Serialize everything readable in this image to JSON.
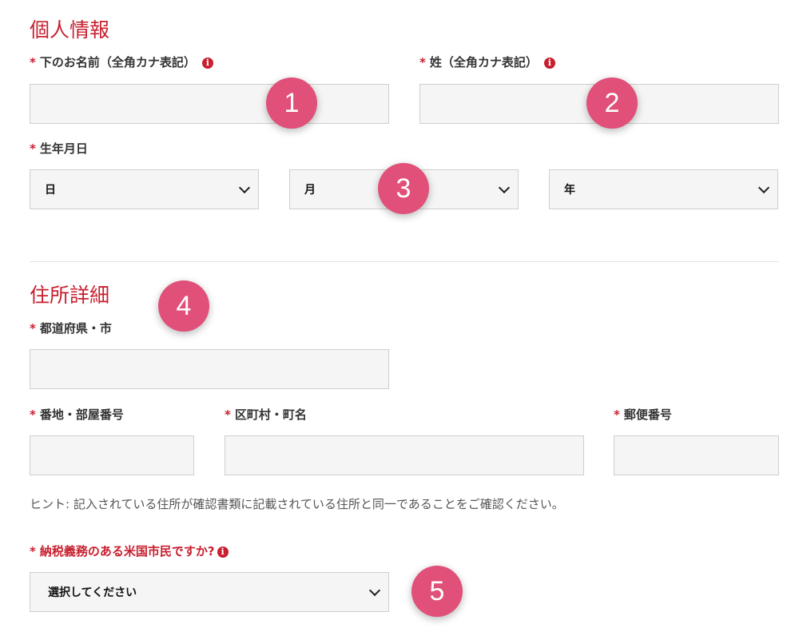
{
  "personal": {
    "title": "個人情報",
    "first_name": {
      "label": "下のお名前（全角カナ表記）",
      "value": ""
    },
    "last_name": {
      "label": "姓（全角カナ表記）",
      "value": ""
    },
    "birthdate": {
      "label": "生年月日",
      "day": "日",
      "month": "月",
      "year": "年"
    }
  },
  "address": {
    "title": "住所詳細",
    "prefecture_city": {
      "label": "都道府県・市",
      "value": ""
    },
    "street_room": {
      "label": "番地・部屋番号",
      "value": ""
    },
    "ward_town": {
      "label": "区町村・町名",
      "value": ""
    },
    "postal_code": {
      "label": "郵便番号",
      "value": ""
    },
    "hint": "ヒント: 記入されている住所が確認書類に記載されている住所と同一であることをご確認ください。"
  },
  "tax": {
    "label": "納税義務のある米国市民ですか?",
    "selected": "選択してください"
  },
  "common": {
    "required_mark": "*",
    "info_glyph": "i"
  },
  "badges": [
    "1",
    "2",
    "3",
    "4",
    "5"
  ],
  "colors": {
    "accent_red": "#c8202f",
    "badge_pink": "#e05078",
    "field_bg": "#f5f5f5",
    "field_border": "#cfcfcf"
  },
  "icons": {
    "info": "info-circle-icon",
    "dropdown": "chevron-down-icon"
  }
}
